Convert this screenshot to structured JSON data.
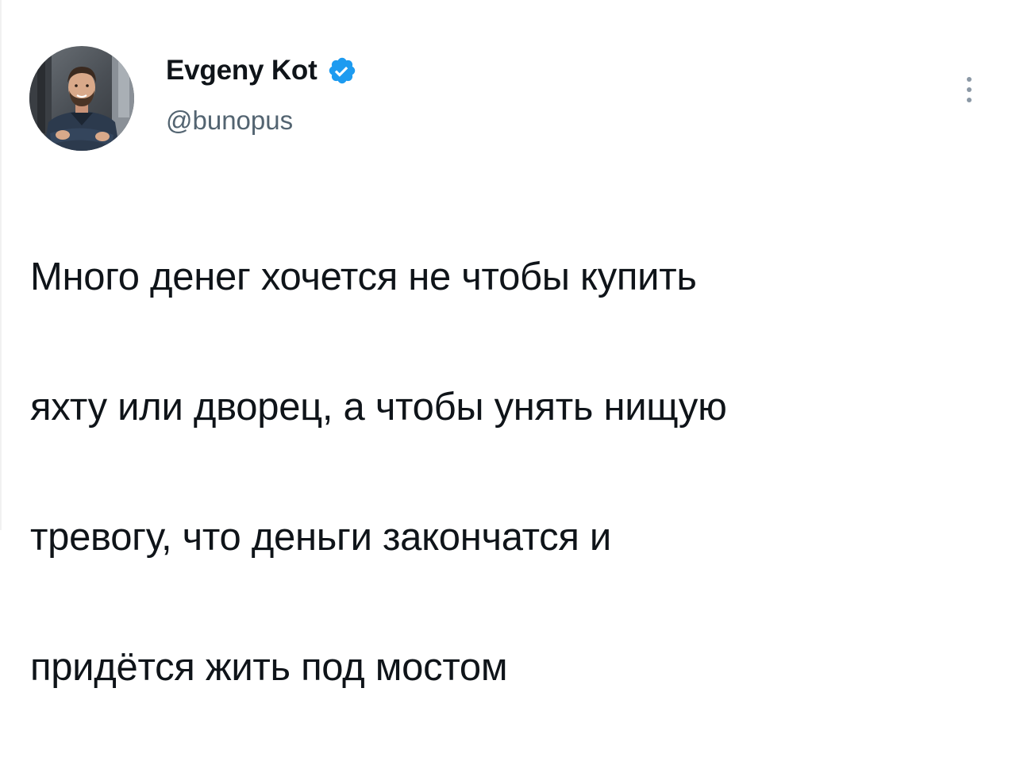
{
  "author": {
    "display_name": "Evgeny Kot",
    "handle": "@bunopus",
    "verified": true,
    "verified_icon": "verified-badge-icon",
    "avatar_icon": "avatar-photo"
  },
  "tweet": {
    "lines": [
      "Много денег хочется не чтобы купить",
      "яхту или дворец, а чтобы унять нищую",
      "тревогу, что деньги закончатся и",
      "придётся жить под мостом"
    ]
  },
  "menu": {
    "icon": "more-vertical-icon"
  },
  "colors": {
    "text": "#0f1419",
    "secondary_text": "#536471",
    "verified_blue": "#1d9bf0",
    "background": "#ffffff"
  }
}
